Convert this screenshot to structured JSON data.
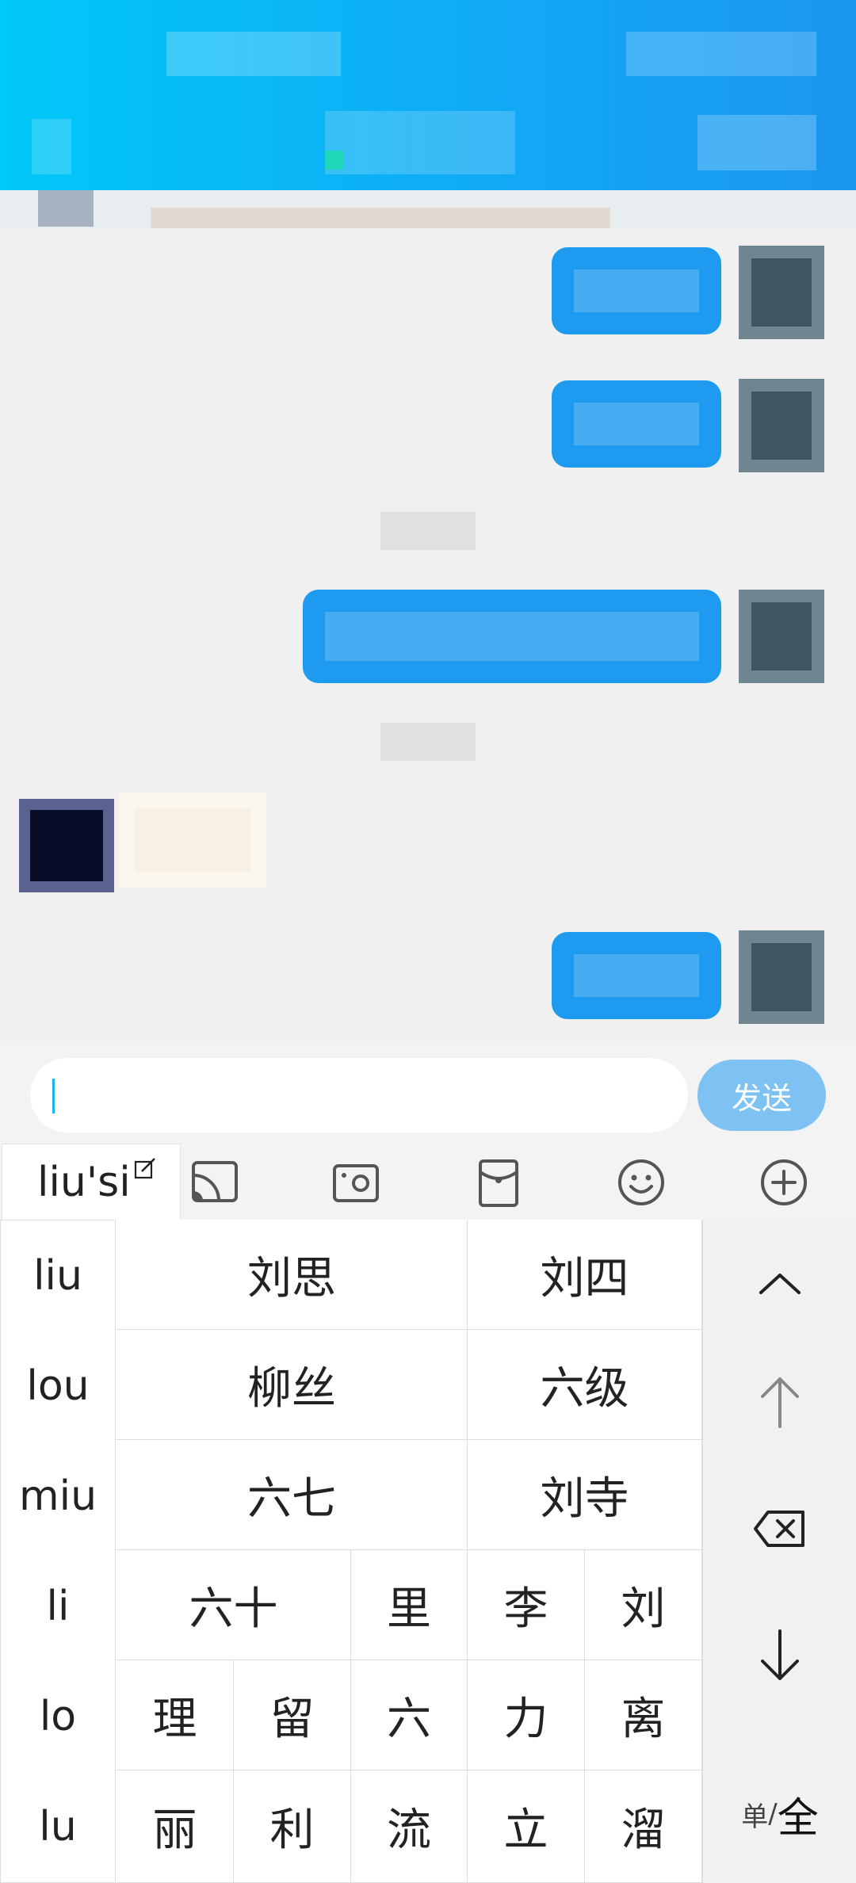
{
  "input": {
    "send_label": "发送"
  },
  "toolbar": {
    "pinyin": "liu'si"
  },
  "keyboard": {
    "pinyin_options": [
      "liu",
      "lou",
      "miu",
      "li",
      "lo",
      "lu"
    ],
    "row1": [
      "刘思",
      "刘四"
    ],
    "row2": [
      "柳丝",
      "六级"
    ],
    "row3": [
      "六七",
      "刘寺"
    ],
    "row4": [
      "六十",
      "里",
      "李",
      "刘"
    ],
    "row5": [
      "理",
      "留",
      "六",
      "力",
      "离"
    ],
    "row6": [
      "丽",
      "利",
      "流",
      "立",
      "溜"
    ],
    "mode_dan": "单",
    "mode_slash": "/",
    "mode_quan": "全"
  },
  "icons": {
    "cast": "cast-icon",
    "camera": "camera-icon",
    "red_packet": "red-packet-icon",
    "emoji": "emoji-icon",
    "more": "add-circle-icon",
    "collapse": "chevron-up-icon",
    "shift": "arrow-up-icon",
    "delete": "backspace-icon",
    "enter": "arrow-down-icon"
  },
  "colors": {
    "header_start": "#00c8f8",
    "header_end": "#1b96f0",
    "bubble_out": "#1e9bf0",
    "send_button": "#7ec2f3",
    "caret": "#18b4ef"
  }
}
